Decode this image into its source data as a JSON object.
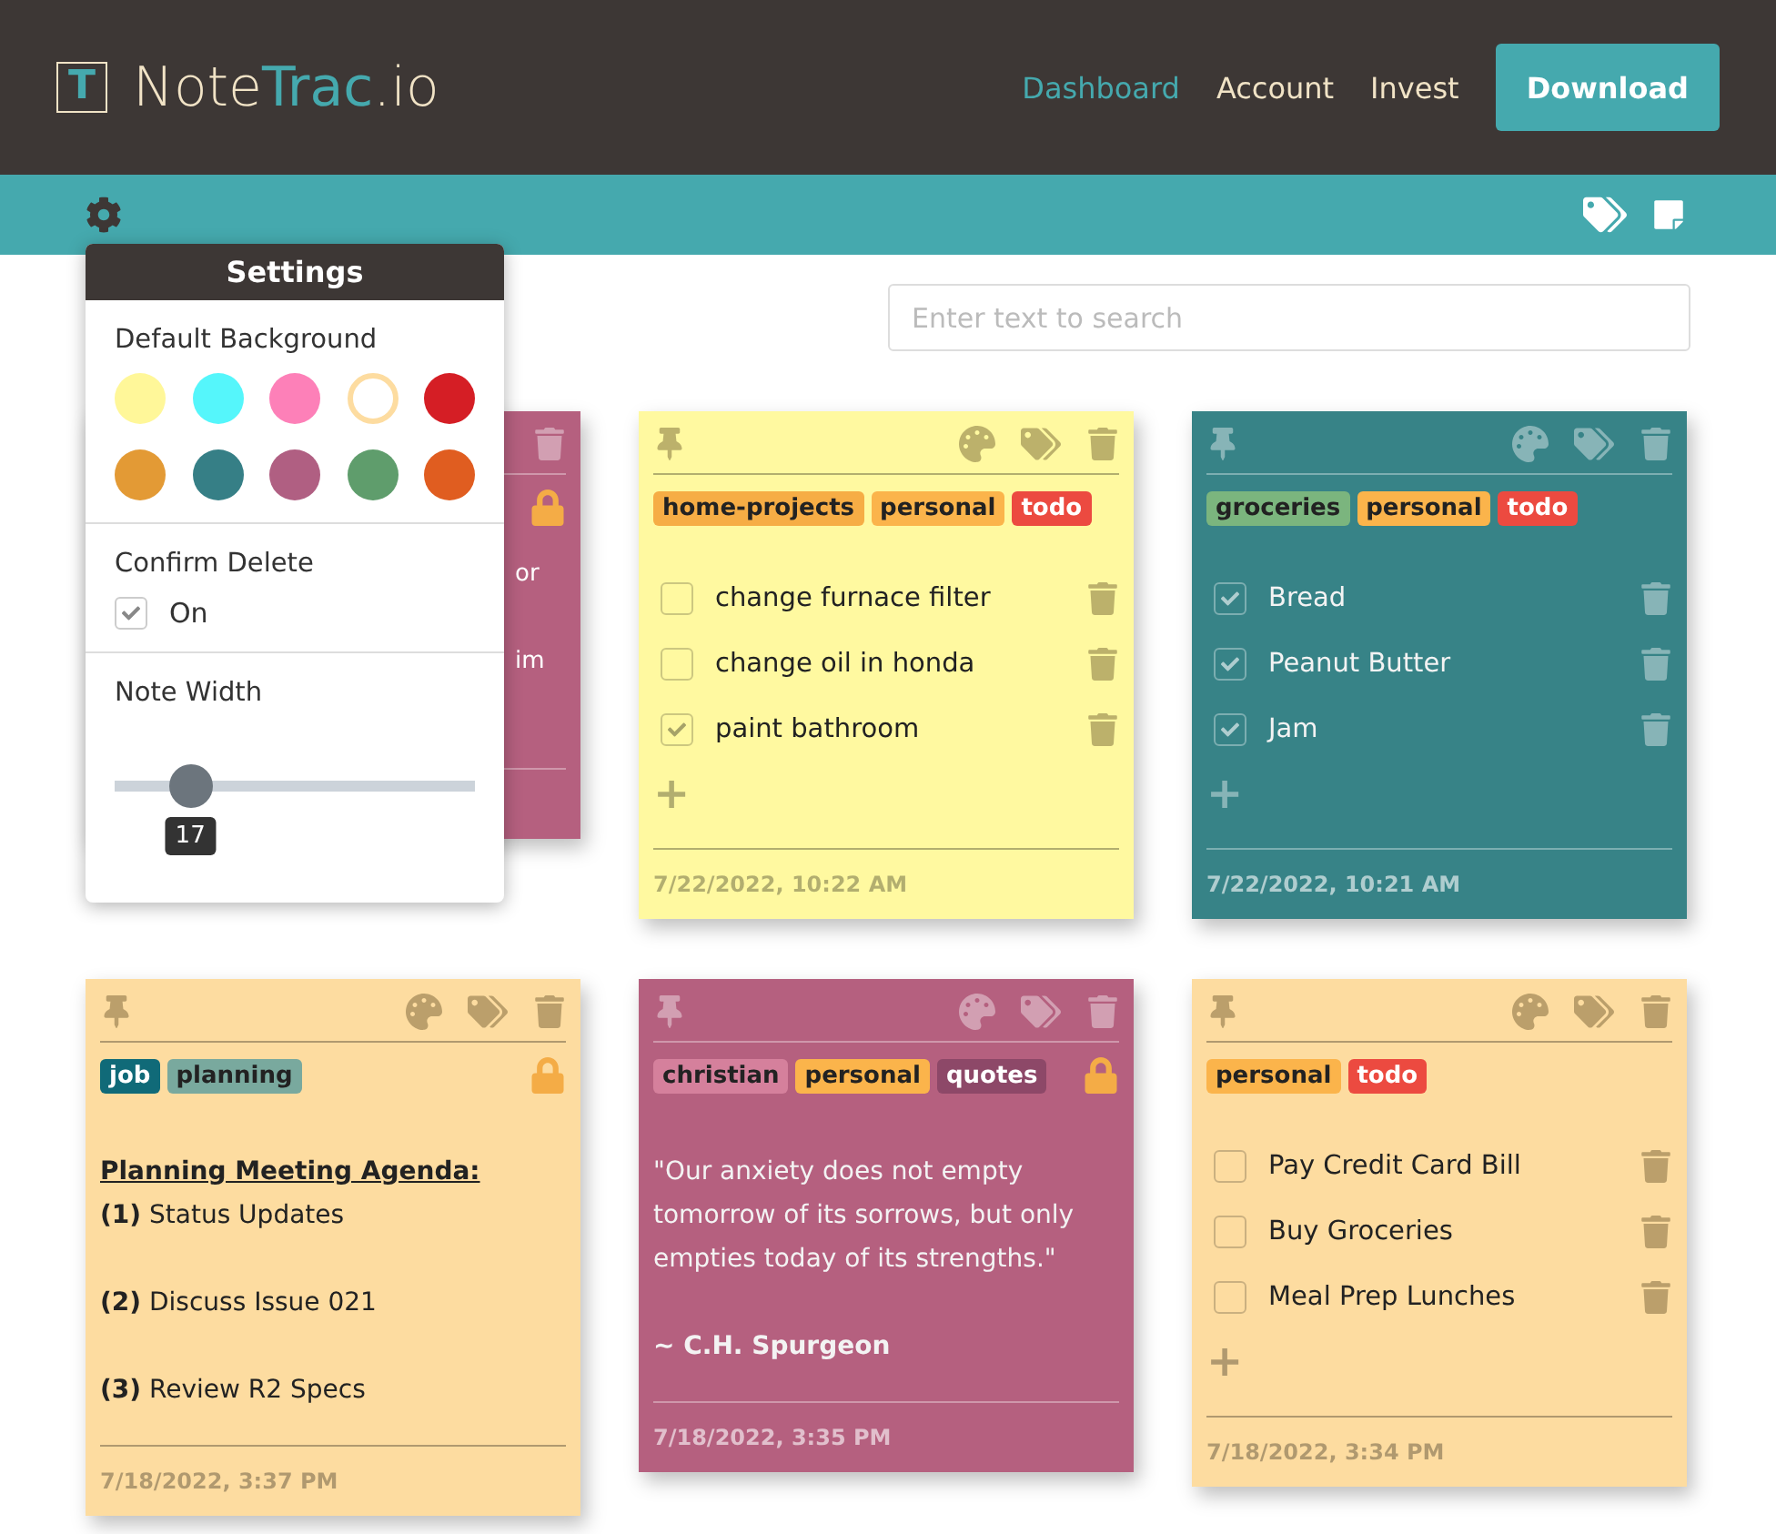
{
  "header": {
    "logo_letter": "T",
    "brand_plain": "Note",
    "brand_bold": "Trac",
    "brand_suffix": ".io",
    "nav": [
      {
        "label": "Dashboard",
        "selected": true
      },
      {
        "label": "Account",
        "selected": false
      },
      {
        "label": "Invest",
        "selected": false
      }
    ],
    "download": "Download"
  },
  "search": {
    "placeholder": "Enter text to search"
  },
  "settings": {
    "title": "Settings",
    "background_label": "Default Background",
    "swatches": [
      {
        "color": "#fff799",
        "selected": false
      },
      {
        "color": "#55f6fb",
        "selected": false
      },
      {
        "color": "#fd80b8",
        "selected": false
      },
      {
        "color": "#fddca0",
        "selected": true
      },
      {
        "color": "#d51e25",
        "selected": false
      },
      {
        "color": "#e39a35",
        "selected": false
      },
      {
        "color": "#367f86",
        "selected": false
      },
      {
        "color": "#b05f82",
        "selected": false
      },
      {
        "color": "#5f9d6c",
        "selected": false
      },
      {
        "color": "#e05d20",
        "selected": false
      }
    ],
    "confirm_label": "Confirm Delete",
    "confirm": {
      "label": "On",
      "checked": true
    },
    "width_label": "Note Width",
    "width": {
      "level": 0.21,
      "reading": "17"
    }
  },
  "notes": [
    {
      "kind": "covered",
      "color": "#b5607f",
      "locked": true,
      "lines": [
        "or",
        "im"
      ]
    },
    {
      "kind": "checklist",
      "color": "#fff9a0",
      "locked": false,
      "tags": [
        {
          "label": "home-projects",
          "color": "#f6ad45"
        },
        {
          "label": "personal",
          "color": "#fbb44b"
        },
        {
          "label": "todo",
          "color": "#ec4a40"
        }
      ],
      "items": [
        {
          "text": "change furnace filter",
          "checked": false
        },
        {
          "text": "change oil in honda",
          "checked": false
        },
        {
          "text": "paint bathroom",
          "checked": true
        }
      ],
      "add": "+",
      "date": "7/22/2022, 10:22 AM"
    },
    {
      "kind": "checklist",
      "color": "#378387",
      "locked": false,
      "tags": [
        {
          "label": "groceries",
          "color": "#7bb57e"
        },
        {
          "label": "personal",
          "color": "#fbb44b"
        },
        {
          "label": "todo",
          "color": "#ec4a40"
        }
      ],
      "items": [
        {
          "text": "Bread",
          "checked": true
        },
        {
          "text": "Peanut Butter",
          "checked": true
        },
        {
          "text": "Jam",
          "checked": true
        }
      ],
      "add": "+",
      "date": "7/22/2022, 10:21 AM"
    },
    {
      "kind": "text",
      "color": "#fddca0",
      "locked": true,
      "tags": [
        {
          "label": "job",
          "color": "#106a78"
        },
        {
          "label": "planning",
          "color": "#79a99e"
        }
      ],
      "lines": [
        {
          "kind": "heading",
          "text": "Planning Meeting Agenda:"
        },
        {
          "kind": "line",
          "text": "**(1)** Status Updates"
        },
        {
          "kind": "line",
          "text": "**(2)** Discuss Issue 021"
        },
        {
          "kind": "line",
          "text": "**(3)** Review R2 Specs"
        }
      ],
      "date": "7/18/2022, 3:37 PM"
    },
    {
      "kind": "text",
      "color": "#b5607f",
      "locked": true,
      "tags": [
        {
          "label": "christian",
          "color": "#d5809c"
        },
        {
          "label": "personal",
          "color": "#fbb44b"
        },
        {
          "label": "quotes",
          "color": "#8d4868"
        }
      ],
      "lines": [
        {
          "kind": "quote",
          "text": "\"Our anxiety does not empty tomorrow of its sorrows, but only empties today of its strengths.\""
        },
        {
          "kind": "signature",
          "text": "~ C.H. Spurgeon"
        }
      ],
      "date": "7/18/2022, 3:35 PM"
    },
    {
      "kind": "checklist",
      "color": "#fddca0",
      "locked": false,
      "tags": [
        {
          "label": "personal",
          "color": "#fbb44b"
        },
        {
          "label": "todo",
          "color": "#ec4a40"
        }
      ],
      "items": [
        {
          "text": "Pay Credit Card Bill",
          "checked": false
        },
        {
          "text": "Buy Groceries",
          "checked": false
        },
        {
          "text": "Meal Prep Lunches",
          "checked": false
        }
      ],
      "add": "+",
      "date": "7/18/2022, 3:34 PM"
    }
  ]
}
